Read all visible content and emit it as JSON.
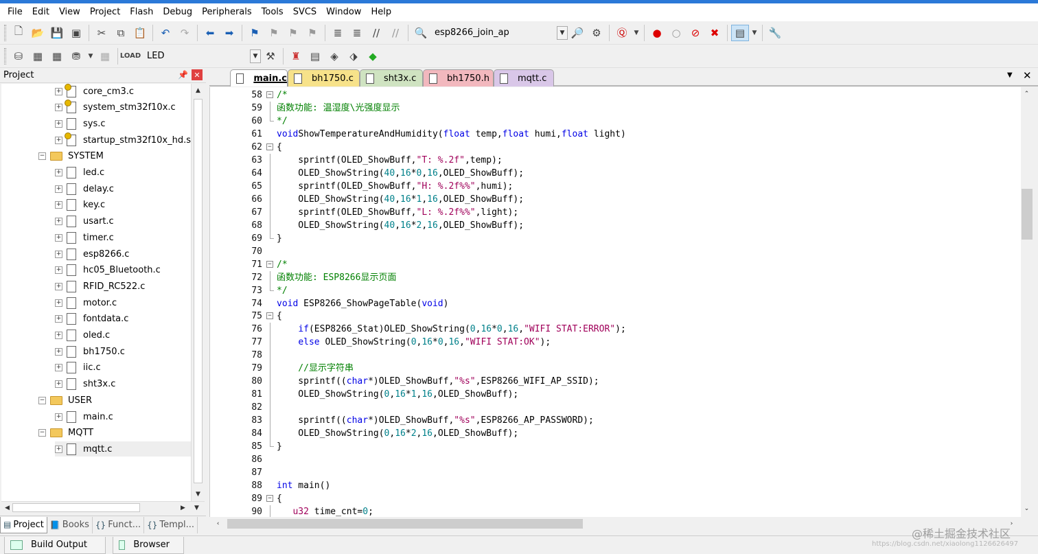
{
  "menu": [
    "File",
    "Edit",
    "View",
    "Project",
    "Flash",
    "Debug",
    "Peripherals",
    "Tools",
    "SVCS",
    "Window",
    "Help"
  ],
  "toolbar1": {
    "target_combo": "esp8266_join_ap"
  },
  "toolbar2": {
    "target_select": "LED"
  },
  "project_panel": {
    "title": "Project",
    "tree": [
      {
        "label": "core_cm3.c",
        "indent": 2,
        "type": "file-key"
      },
      {
        "label": "system_stm32f10x.c",
        "indent": 2,
        "type": "file-key"
      },
      {
        "label": "sys.c",
        "indent": 2,
        "type": "file"
      },
      {
        "label": "startup_stm32f10x_hd.s",
        "indent": 2,
        "type": "file-key"
      },
      {
        "label": "SYSTEM",
        "indent": 1,
        "type": "folder"
      },
      {
        "label": "led.c",
        "indent": 2,
        "type": "file"
      },
      {
        "label": "delay.c",
        "indent": 2,
        "type": "file"
      },
      {
        "label": "key.c",
        "indent": 2,
        "type": "file"
      },
      {
        "label": "usart.c",
        "indent": 2,
        "type": "file"
      },
      {
        "label": "timer.c",
        "indent": 2,
        "type": "file"
      },
      {
        "label": "esp8266.c",
        "indent": 2,
        "type": "file"
      },
      {
        "label": "hc05_Bluetooth.c",
        "indent": 2,
        "type": "file"
      },
      {
        "label": "RFID_RC522.c",
        "indent": 2,
        "type": "file"
      },
      {
        "label": "motor.c",
        "indent": 2,
        "type": "file"
      },
      {
        "label": "fontdata.c",
        "indent": 2,
        "type": "file"
      },
      {
        "label": "oled.c",
        "indent": 2,
        "type": "file"
      },
      {
        "label": "bh1750.c",
        "indent": 2,
        "type": "file"
      },
      {
        "label": "iic.c",
        "indent": 2,
        "type": "file"
      },
      {
        "label": "sht3x.c",
        "indent": 2,
        "type": "file"
      },
      {
        "label": "USER",
        "indent": 1,
        "type": "folder"
      },
      {
        "label": "main.c",
        "indent": 2,
        "type": "file"
      },
      {
        "label": "MQTT",
        "indent": 1,
        "type": "folder"
      },
      {
        "label": "mqtt.c",
        "indent": 2,
        "type": "file",
        "selected": true
      }
    ],
    "tabs": [
      {
        "label": "Project",
        "icon": "project-icon",
        "active": true
      },
      {
        "label": "Books",
        "icon": "books-icon"
      },
      {
        "label": "Funct...",
        "icon": "functions-icon"
      },
      {
        "label": "Templ...",
        "icon": "templates-icon"
      }
    ]
  },
  "editor": {
    "tabs": [
      {
        "label": "main.c",
        "color": "#f0f0f0",
        "active": true
      },
      {
        "label": "bh1750.c",
        "color": "#f7e28a"
      },
      {
        "label": "sht3x.c",
        "color": "#cfe3c1"
      },
      {
        "label": "bh1750.h",
        "color": "#f2b8be"
      },
      {
        "label": "mqtt.c",
        "color": "#d9c7e8"
      }
    ],
    "lines": [
      {
        "n": "58",
        "fold": "start",
        "code": [
          [
            "cm",
            "/*"
          ]
        ]
      },
      {
        "n": "59",
        "fold": "line",
        "code": [
          [
            "cm",
            "函数功能: 温湿度\\光强度显示"
          ]
        ]
      },
      {
        "n": "60",
        "fold": "end",
        "code": [
          [
            "cm",
            "*/"
          ]
        ]
      },
      {
        "n": "61",
        "fold": "",
        "code": [
          [
            "kw",
            "void"
          ],
          [
            "",
            "ShowTemperatureAndHumidity("
          ],
          [
            "kw",
            "float"
          ],
          [
            "",
            " temp,"
          ],
          [
            "kw",
            "float"
          ],
          [
            "",
            " humi,"
          ],
          [
            "kw",
            "float"
          ],
          [
            "",
            " light)"
          ]
        ]
      },
      {
        "n": "62",
        "fold": "start",
        "code": [
          [
            "",
            "{"
          ]
        ]
      },
      {
        "n": "63",
        "fold": "line",
        "code": [
          [
            "",
            "    sprintf(OLED_ShowBuff,"
          ],
          [
            "str",
            "\"T: %.2f\""
          ],
          [
            "",
            ",temp);"
          ]
        ]
      },
      {
        "n": "64",
        "fold": "line",
        "code": [
          [
            "",
            "    OLED_ShowString("
          ],
          [
            "num",
            "40"
          ],
          [
            "",
            ","
          ],
          [
            "num",
            "16"
          ],
          [
            "",
            "*"
          ],
          [
            "num",
            "0"
          ],
          [
            "",
            ","
          ],
          [
            "num",
            "16"
          ],
          [
            "",
            ",OLED_ShowBuff);"
          ]
        ]
      },
      {
        "n": "65",
        "fold": "line",
        "code": [
          [
            "",
            "    sprintf(OLED_ShowBuff,"
          ],
          [
            "str",
            "\"H: %.2f%%\""
          ],
          [
            "",
            ",humi);"
          ]
        ]
      },
      {
        "n": "66",
        "fold": "line",
        "code": [
          [
            "",
            "    OLED_ShowString("
          ],
          [
            "num",
            "40"
          ],
          [
            "",
            ","
          ],
          [
            "num",
            "16"
          ],
          [
            "",
            "*"
          ],
          [
            "num",
            "1"
          ],
          [
            "",
            ","
          ],
          [
            "num",
            "16"
          ],
          [
            "",
            ",OLED_ShowBuff);"
          ]
        ]
      },
      {
        "n": "67",
        "fold": "line",
        "code": [
          [
            "",
            "    sprintf(OLED_ShowBuff,"
          ],
          [
            "str",
            "\"L: %.2f%%\""
          ],
          [
            "",
            ",light);"
          ]
        ]
      },
      {
        "n": "68",
        "fold": "line",
        "code": [
          [
            "",
            "    OLED_ShowString("
          ],
          [
            "num",
            "40"
          ],
          [
            "",
            ","
          ],
          [
            "num",
            "16"
          ],
          [
            "",
            "*"
          ],
          [
            "num",
            "2"
          ],
          [
            "",
            ","
          ],
          [
            "num",
            "16"
          ],
          [
            "",
            ",OLED_ShowBuff);"
          ]
        ]
      },
      {
        "n": "69",
        "fold": "end",
        "code": [
          [
            "",
            "}"
          ]
        ]
      },
      {
        "n": "70",
        "fold": "",
        "code": []
      },
      {
        "n": "71",
        "fold": "start",
        "code": [
          [
            "cm",
            "/*"
          ]
        ]
      },
      {
        "n": "72",
        "fold": "line",
        "code": [
          [
            "cm",
            "函数功能: ESP8266显示页面"
          ]
        ]
      },
      {
        "n": "73",
        "fold": "end",
        "code": [
          [
            "cm",
            "*/"
          ]
        ]
      },
      {
        "n": "74",
        "fold": "",
        "code": [
          [
            "kw",
            "void"
          ],
          [
            "",
            " ESP8266_ShowPageTable("
          ],
          [
            "kw",
            "void"
          ],
          [
            "",
            ")"
          ]
        ]
      },
      {
        "n": "75",
        "fold": "start",
        "code": [
          [
            "",
            "{"
          ]
        ]
      },
      {
        "n": "76",
        "fold": "line",
        "code": [
          [
            "",
            "    "
          ],
          [
            "kw",
            "if"
          ],
          [
            "",
            "(ESP8266_Stat)OLED_ShowString("
          ],
          [
            "num",
            "0"
          ],
          [
            "",
            ","
          ],
          [
            "num",
            "16"
          ],
          [
            "",
            "*"
          ],
          [
            "num",
            "0"
          ],
          [
            "",
            ","
          ],
          [
            "num",
            "16"
          ],
          [
            "",
            ","
          ],
          [
            "str",
            "\"WIFI STAT:ERROR\""
          ],
          [
            "",
            ");"
          ]
        ]
      },
      {
        "n": "77",
        "fold": "line",
        "code": [
          [
            "",
            "    "
          ],
          [
            "kw",
            "else"
          ],
          [
            "",
            " OLED_ShowString("
          ],
          [
            "num",
            "0"
          ],
          [
            "",
            ","
          ],
          [
            "num",
            "16"
          ],
          [
            "",
            "*"
          ],
          [
            "num",
            "0"
          ],
          [
            "",
            ","
          ],
          [
            "num",
            "16"
          ],
          [
            "",
            ","
          ],
          [
            "str",
            "\"WIFI STAT:OK\""
          ],
          [
            "",
            ");"
          ]
        ]
      },
      {
        "n": "78",
        "fold": "line",
        "code": []
      },
      {
        "n": "79",
        "fold": "line",
        "code": [
          [
            "cm",
            "    //显示字符串"
          ]
        ]
      },
      {
        "n": "80",
        "fold": "line",
        "code": [
          [
            "",
            "    sprintf(("
          ],
          [
            "kw",
            "char"
          ],
          [
            "",
            "*)OLED_ShowBuff,"
          ],
          [
            "str",
            "\"%s\""
          ],
          [
            "",
            ",ESP8266_WIFI_AP_SSID);"
          ]
        ]
      },
      {
        "n": "81",
        "fold": "line",
        "code": [
          [
            "",
            "    OLED_ShowString("
          ],
          [
            "num",
            "0"
          ],
          [
            "",
            ","
          ],
          [
            "num",
            "16"
          ],
          [
            "",
            "*"
          ],
          [
            "num",
            "1"
          ],
          [
            "",
            ","
          ],
          [
            "num",
            "16"
          ],
          [
            "",
            ",OLED_ShowBuff);"
          ]
        ]
      },
      {
        "n": "82",
        "fold": "line",
        "code": []
      },
      {
        "n": "83",
        "fold": "line",
        "code": [
          [
            "",
            "    sprintf(("
          ],
          [
            "kw",
            "char"
          ],
          [
            "",
            "*)OLED_ShowBuff,"
          ],
          [
            "str",
            "\"%s\""
          ],
          [
            "",
            ",ESP8266_AP_PASSWORD);"
          ]
        ]
      },
      {
        "n": "84",
        "fold": "line",
        "code": [
          [
            "",
            "    OLED_ShowString("
          ],
          [
            "num",
            "0"
          ],
          [
            "",
            ","
          ],
          [
            "num",
            "16"
          ],
          [
            "",
            "*"
          ],
          [
            "num",
            "2"
          ],
          [
            "",
            ","
          ],
          [
            "num",
            "16"
          ],
          [
            "",
            ",OLED_ShowBuff);"
          ]
        ]
      },
      {
        "n": "85",
        "fold": "end",
        "code": [
          [
            "",
            "}"
          ]
        ]
      },
      {
        "n": "86",
        "fold": "",
        "code": []
      },
      {
        "n": "87",
        "fold": "",
        "code": []
      },
      {
        "n": "88",
        "fold": "",
        "code": [
          [
            "kw",
            "int"
          ],
          [
            "",
            " main()"
          ]
        ]
      },
      {
        "n": "89",
        "fold": "start",
        "code": [
          [
            "",
            "{"
          ]
        ]
      },
      {
        "n": "90",
        "fold": "line",
        "code": [
          [
            "",
            "   "
          ],
          [
            "ty",
            "u32"
          ],
          [
            "",
            " time_cnt="
          ],
          [
            "num",
            "0"
          ],
          [
            "",
            ";"
          ]
        ]
      }
    ]
  },
  "bottom_tabs": [
    {
      "label": "Build Output"
    },
    {
      "label": "Browser"
    }
  ],
  "watermark": "@稀土掘金技术社区",
  "watermark_url": "https://blog.csdn.net/xiaolong1126626497"
}
